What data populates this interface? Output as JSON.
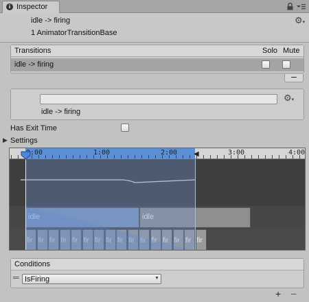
{
  "window": {
    "tab_label": "Inspector",
    "tab_icon": "info-icon",
    "lock_icon": "lock-icon",
    "menu_icon": "tab-menu-icon"
  },
  "header": {
    "title": "idle -> firing",
    "subtitle": "1 AnimatorTransitionBase",
    "settings_icon": "gear-icon"
  },
  "transitions": {
    "header": "Transitions",
    "solo_label": "Solo",
    "mute_label": "Mute",
    "items": [
      {
        "label": "idle -> firing",
        "solo": false,
        "mute": false,
        "selected": true
      }
    ],
    "remove_symbol": "–"
  },
  "detail": {
    "name_value": "",
    "label": "idle -> firing"
  },
  "has_exit_time": {
    "label": "Has Exit Time",
    "checked": false
  },
  "settings": {
    "label": "Settings",
    "expanded": false
  },
  "timeline": {
    "ruler_labels": [
      "0:00",
      "1:00",
      "2:00",
      "3:00",
      "4:00"
    ],
    "source_clip": "idle",
    "dest_clip": "idle",
    "frame_label": "fir",
    "frame_count": 16
  },
  "conditions": {
    "header": "Conditions",
    "items": [
      {
        "parameter": "IsFiring"
      }
    ],
    "add_symbol": "+",
    "remove_symbol": "–"
  }
}
